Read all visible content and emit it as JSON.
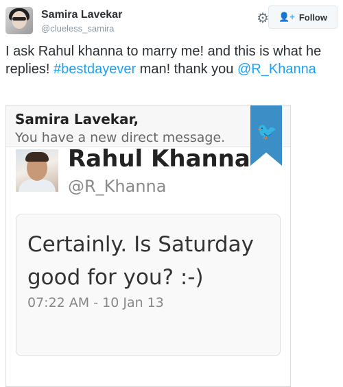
{
  "tweet": {
    "author": {
      "name": "Samira Lavekar",
      "handle": "@clueless_samira"
    },
    "follow_label": "Follow",
    "text_before": "I ask Rahul khanna to marry me! and this is what he replies! ",
    "hashtag": "#bestdayever",
    "text_middle": " man! thank you ",
    "mention": "@R_Khanna"
  },
  "dm_card": {
    "recipient": "Samira Lavekar,",
    "notice": "You have a new direct message.",
    "sender": {
      "name": "Rahul Khanna",
      "handle": "@R_Khanna"
    },
    "message": "Certainly. Is Saturday good for you? :-)",
    "timestamp": "07:22 AM - 10 Jan 13"
  },
  "colors": {
    "link": "#1da1f2",
    "ribbon": "#3b8ec6"
  },
  "icons": {
    "settings": "gear-icon",
    "follow": "add-user-icon",
    "brand": "twitter-bird-icon"
  }
}
